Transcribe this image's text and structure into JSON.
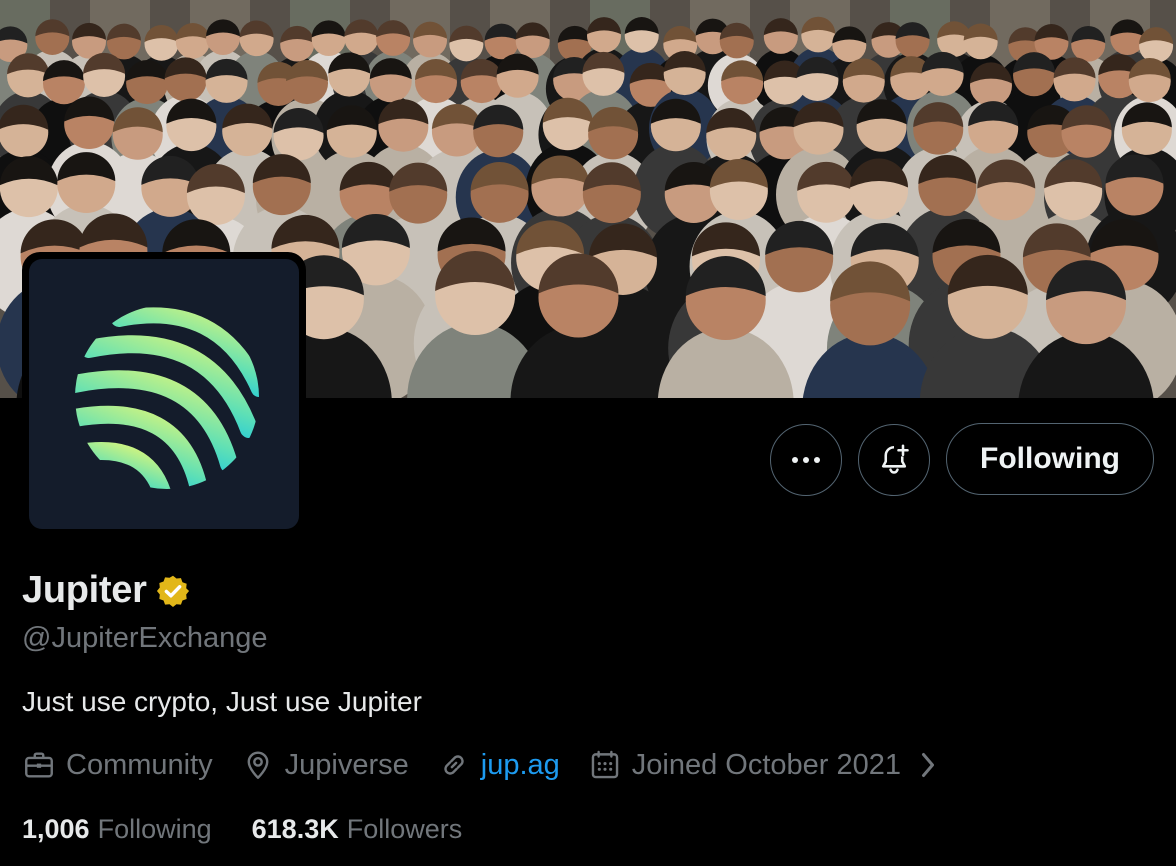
{
  "profile": {
    "display_name": "Jupiter",
    "handle": "@JupiterExchange",
    "bio": "Just use crypto, Just use Jupiter",
    "verified_badge_icon": "gold-verified-badge-icon",
    "category": "Community",
    "location": "Jupiverse",
    "website": "jup.ag",
    "joined": "Joined October 2021"
  },
  "stats": {
    "following_count": "1,006",
    "following_label": "Following",
    "followers_count": "618.3K",
    "followers_label": "Followers"
  },
  "actions": {
    "follow_button_label": "Following",
    "more_icon": "more-horizontal-icon",
    "notify_icon": "bell-plus-icon"
  },
  "banner": {
    "description_icon": "group-photo-banner"
  },
  "colors": {
    "background": "#000000",
    "text_primary": "#e7e9ea",
    "text_secondary": "#71767b",
    "link": "#1d9bf0",
    "border": "#536471",
    "verified_gold": "#e2b719",
    "logo_gradient_start": "#c7f284",
    "logo_gradient_end": "#00bef0"
  }
}
